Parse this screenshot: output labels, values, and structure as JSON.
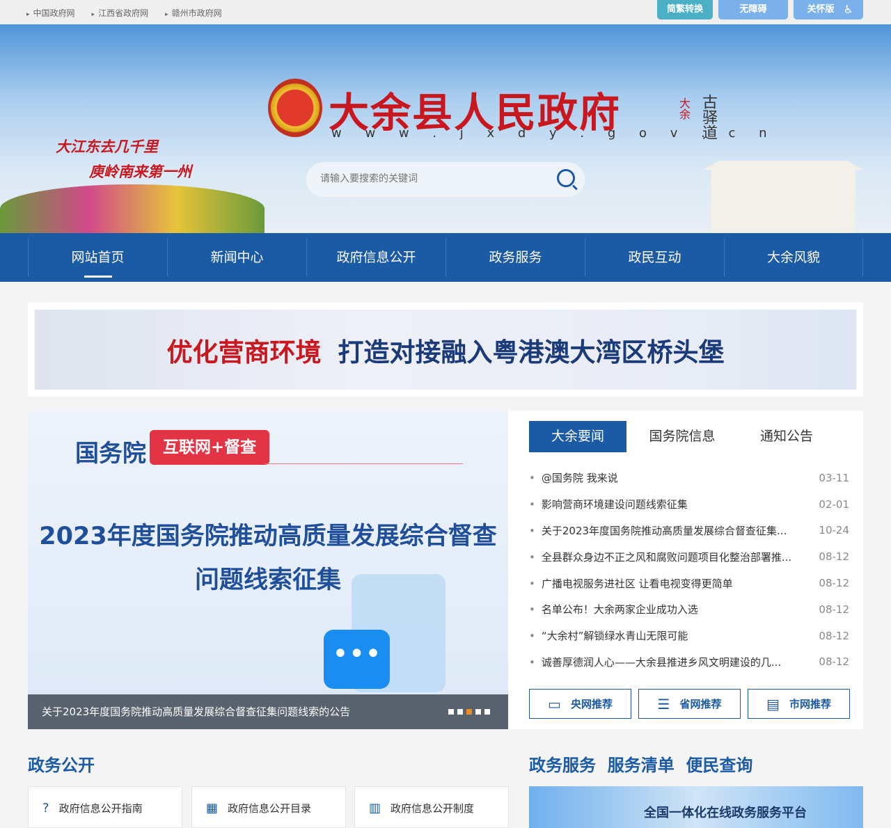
{
  "topbar": {
    "links": [
      "中国政府网",
      "江西省政府网",
      "赣州市政府网"
    ],
    "buttons": [
      "简繁转换",
      "无障碍",
      "关怀版"
    ]
  },
  "header": {
    "title": "大余县人民政府",
    "url": "w w w . j x d y . g o v . c n",
    "slogan1": "大江东去几千里",
    "slogan2": "庾岭南来第一州",
    "seal": [
      "大余",
      "古驿道"
    ],
    "search_placeholder": "请输入要搜索的关键词"
  },
  "nav": [
    "网站首页",
    "新闻中心",
    "政府信息公开",
    "政务服务",
    "政民互动",
    "大余风貌"
  ],
  "ad": {
    "red": "优化营商环境",
    "blue": "打造对接融入粤港澳大湾区桥头堡"
  },
  "slide": {
    "org": "国务院",
    "tag": "互联网+督查",
    "line1": "2023年度国务院推动高质量发展综合督查",
    "line2": "问题线索征集",
    "caption": "关于2023年度国务院推动高质量发展综合督查征集问题线索的公告",
    "active_dot": 3,
    "dot_count": 5
  },
  "news": {
    "tabs": [
      "大余要闻",
      "国务院信息",
      "通知公告"
    ],
    "items": [
      {
        "title": "@国务院 我来说",
        "date": "03-11"
      },
      {
        "title": "影响营商环境建设问题线索征集",
        "date": "02-01"
      },
      {
        "title": "关于2023年度国务院推动高质量发展综合督查征集...",
        "date": "10-24"
      },
      {
        "title": "全县群众身边不正之风和腐败问题项目化整治部署推...",
        "date": "08-12"
      },
      {
        "title": "广播电视服务进社区 让看电视变得更简单",
        "date": "08-12"
      },
      {
        "title": "名单公布！大余两家企业成功入选",
        "date": "08-12"
      },
      {
        "title": "“大余村”解锁绿水青山无限可能",
        "date": "08-12"
      },
      {
        "title": "诚善厚德润人心——大余县推进乡风文明建设的几...",
        "date": "08-12"
      }
    ],
    "buttons": [
      "央网推荐",
      "省网推荐",
      "市网推荐"
    ]
  },
  "sections": {
    "left": "政务公开",
    "right": [
      "政务服务",
      "服务清单",
      "便民查询"
    ],
    "cards": [
      "政府信息公开指南",
      "政府信息公开目录",
      "政府信息公开制度"
    ],
    "service": "全国一体化在线政务服务平台"
  }
}
